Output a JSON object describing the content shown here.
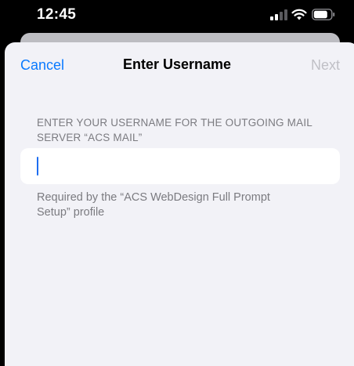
{
  "status_bar": {
    "time": "12:45",
    "signal_icon": "cellular-signal-icon",
    "wifi_icon": "wifi-icon",
    "battery_icon": "battery-icon"
  },
  "nav": {
    "cancel_label": "Cancel",
    "title": "Enter Username",
    "next_label": "Next"
  },
  "form": {
    "section_header": "ENTER YOUR USERNAME FOR THE OUTGOING MAIL SERVER “ACS MAIL”",
    "username_value": "",
    "footer_note": "Required by the “ACS WebDesign Full Prompt Setup” profile"
  },
  "colors": {
    "accent": "#0a7aff",
    "disabled": "#c0c0c6",
    "secondary_text": "#7b7b80",
    "sheet_background": "#f2f2f7"
  }
}
